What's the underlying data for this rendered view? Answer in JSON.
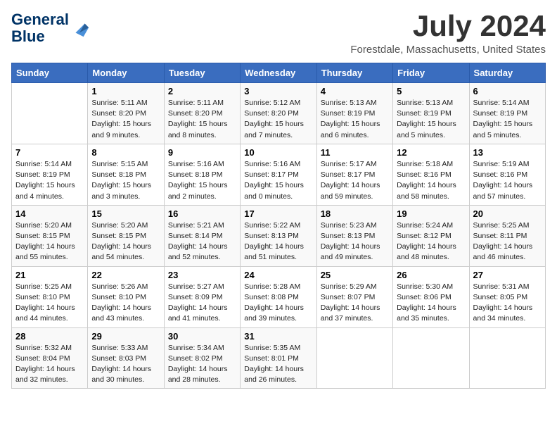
{
  "header": {
    "logo_line1": "General",
    "logo_line2": "Blue",
    "month_title": "July 2024",
    "location": "Forestdale, Massachusetts, United States"
  },
  "weekdays": [
    "Sunday",
    "Monday",
    "Tuesday",
    "Wednesday",
    "Thursday",
    "Friday",
    "Saturday"
  ],
  "weeks": [
    [
      {
        "day": "",
        "info": ""
      },
      {
        "day": "1",
        "info": "Sunrise: 5:11 AM\nSunset: 8:20 PM\nDaylight: 15 hours\nand 9 minutes."
      },
      {
        "day": "2",
        "info": "Sunrise: 5:11 AM\nSunset: 8:20 PM\nDaylight: 15 hours\nand 8 minutes."
      },
      {
        "day": "3",
        "info": "Sunrise: 5:12 AM\nSunset: 8:20 PM\nDaylight: 15 hours\nand 7 minutes."
      },
      {
        "day": "4",
        "info": "Sunrise: 5:13 AM\nSunset: 8:19 PM\nDaylight: 15 hours\nand 6 minutes."
      },
      {
        "day": "5",
        "info": "Sunrise: 5:13 AM\nSunset: 8:19 PM\nDaylight: 15 hours\nand 5 minutes."
      },
      {
        "day": "6",
        "info": "Sunrise: 5:14 AM\nSunset: 8:19 PM\nDaylight: 15 hours\nand 5 minutes."
      }
    ],
    [
      {
        "day": "7",
        "info": "Sunrise: 5:14 AM\nSunset: 8:19 PM\nDaylight: 15 hours\nand 4 minutes."
      },
      {
        "day": "8",
        "info": "Sunrise: 5:15 AM\nSunset: 8:18 PM\nDaylight: 15 hours\nand 3 minutes."
      },
      {
        "day": "9",
        "info": "Sunrise: 5:16 AM\nSunset: 8:18 PM\nDaylight: 15 hours\nand 2 minutes."
      },
      {
        "day": "10",
        "info": "Sunrise: 5:16 AM\nSunset: 8:17 PM\nDaylight: 15 hours\nand 0 minutes."
      },
      {
        "day": "11",
        "info": "Sunrise: 5:17 AM\nSunset: 8:17 PM\nDaylight: 14 hours\nand 59 minutes."
      },
      {
        "day": "12",
        "info": "Sunrise: 5:18 AM\nSunset: 8:16 PM\nDaylight: 14 hours\nand 58 minutes."
      },
      {
        "day": "13",
        "info": "Sunrise: 5:19 AM\nSunset: 8:16 PM\nDaylight: 14 hours\nand 57 minutes."
      }
    ],
    [
      {
        "day": "14",
        "info": "Sunrise: 5:20 AM\nSunset: 8:15 PM\nDaylight: 14 hours\nand 55 minutes."
      },
      {
        "day": "15",
        "info": "Sunrise: 5:20 AM\nSunset: 8:15 PM\nDaylight: 14 hours\nand 54 minutes."
      },
      {
        "day": "16",
        "info": "Sunrise: 5:21 AM\nSunset: 8:14 PM\nDaylight: 14 hours\nand 52 minutes."
      },
      {
        "day": "17",
        "info": "Sunrise: 5:22 AM\nSunset: 8:13 PM\nDaylight: 14 hours\nand 51 minutes."
      },
      {
        "day": "18",
        "info": "Sunrise: 5:23 AM\nSunset: 8:13 PM\nDaylight: 14 hours\nand 49 minutes."
      },
      {
        "day": "19",
        "info": "Sunrise: 5:24 AM\nSunset: 8:12 PM\nDaylight: 14 hours\nand 48 minutes."
      },
      {
        "day": "20",
        "info": "Sunrise: 5:25 AM\nSunset: 8:11 PM\nDaylight: 14 hours\nand 46 minutes."
      }
    ],
    [
      {
        "day": "21",
        "info": "Sunrise: 5:25 AM\nSunset: 8:10 PM\nDaylight: 14 hours\nand 44 minutes."
      },
      {
        "day": "22",
        "info": "Sunrise: 5:26 AM\nSunset: 8:10 PM\nDaylight: 14 hours\nand 43 minutes."
      },
      {
        "day": "23",
        "info": "Sunrise: 5:27 AM\nSunset: 8:09 PM\nDaylight: 14 hours\nand 41 minutes."
      },
      {
        "day": "24",
        "info": "Sunrise: 5:28 AM\nSunset: 8:08 PM\nDaylight: 14 hours\nand 39 minutes."
      },
      {
        "day": "25",
        "info": "Sunrise: 5:29 AM\nSunset: 8:07 PM\nDaylight: 14 hours\nand 37 minutes."
      },
      {
        "day": "26",
        "info": "Sunrise: 5:30 AM\nSunset: 8:06 PM\nDaylight: 14 hours\nand 35 minutes."
      },
      {
        "day": "27",
        "info": "Sunrise: 5:31 AM\nSunset: 8:05 PM\nDaylight: 14 hours\nand 34 minutes."
      }
    ],
    [
      {
        "day": "28",
        "info": "Sunrise: 5:32 AM\nSunset: 8:04 PM\nDaylight: 14 hours\nand 32 minutes."
      },
      {
        "day": "29",
        "info": "Sunrise: 5:33 AM\nSunset: 8:03 PM\nDaylight: 14 hours\nand 30 minutes."
      },
      {
        "day": "30",
        "info": "Sunrise: 5:34 AM\nSunset: 8:02 PM\nDaylight: 14 hours\nand 28 minutes."
      },
      {
        "day": "31",
        "info": "Sunrise: 5:35 AM\nSunset: 8:01 PM\nDaylight: 14 hours\nand 26 minutes."
      },
      {
        "day": "",
        "info": ""
      },
      {
        "day": "",
        "info": ""
      },
      {
        "day": "",
        "info": ""
      }
    ]
  ]
}
